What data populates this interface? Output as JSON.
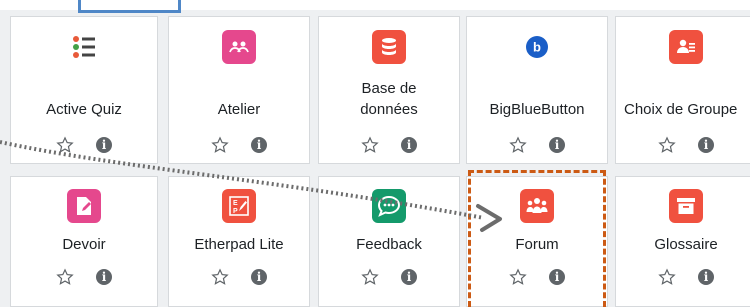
{
  "activities": {
    "row1": [
      {
        "label": "Active Quiz"
      },
      {
        "label": "Atelier"
      },
      {
        "label_line1": "Base de",
        "label_line2": "données"
      },
      {
        "label": "BigBlueButton"
      },
      {
        "label": "Choix de Groupe"
      }
    ],
    "row2": [
      {
        "label": "Devoir"
      },
      {
        "label": "Etherpad Lite"
      },
      {
        "label": "Feedback"
      },
      {
        "label": "Forum"
      },
      {
        "label": "Glossaire"
      }
    ]
  },
  "colors": {
    "highlight_blue": "#4f87c7",
    "highlight_orange": "#cc5a14",
    "pink": "#e5488d",
    "red_orange": "#f0513f",
    "green": "#149a6b",
    "bbb_blue": "#1a5ec7"
  },
  "icons": {
    "active_quiz": "list-icon",
    "atelier": "workshop-icon",
    "base": "database-icon",
    "bbb": "bigbluebutton-icon",
    "choix": "group-choice-icon",
    "devoir": "assignment-icon",
    "etherpad": "etherpad-icon",
    "feedback": "feedback-icon",
    "forum": "forum-icon",
    "glossaire": "glossary-icon",
    "star": "star-outline-icon",
    "info": "info-icon"
  }
}
